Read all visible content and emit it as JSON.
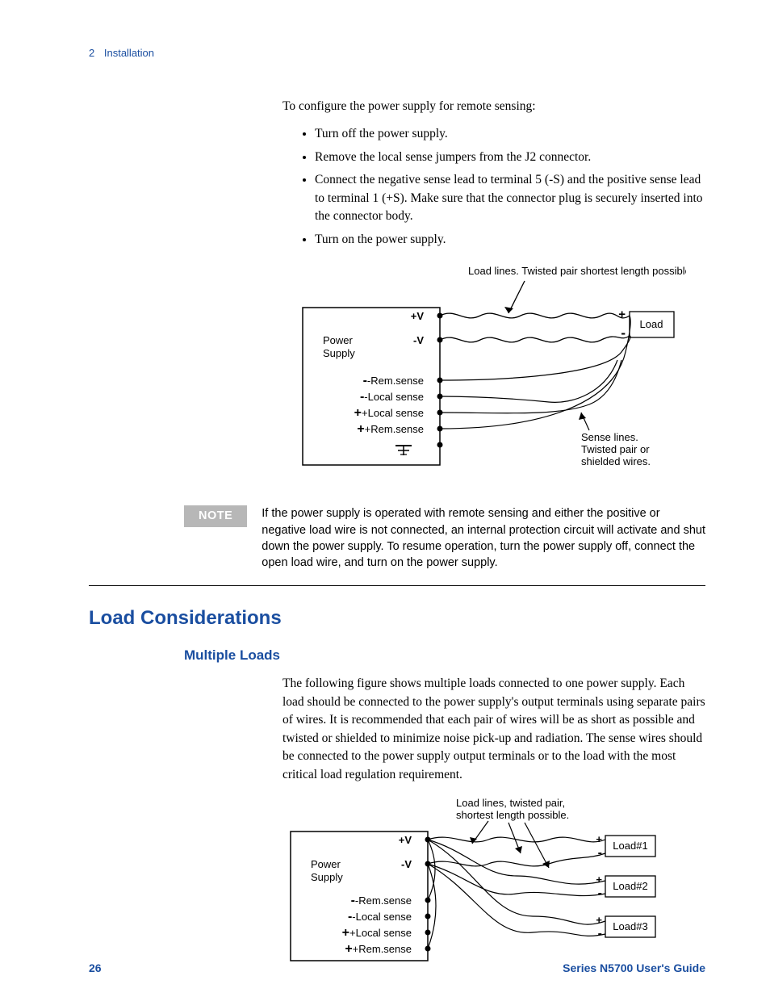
{
  "header": {
    "chapter_num": "2",
    "chapter_title": "Installation"
  },
  "intro": "To configure the power supply for remote sensing:",
  "steps": [
    "Turn off the power supply.",
    "Remove the local sense jumpers from the J2 connector.",
    "Connect the negative sense lead to terminal 5 (-S) and the positive sense lead to terminal 1 (+S). Make sure that the connector plug is securely inserted into the connector body.",
    "Turn on the power supply."
  ],
  "diagram1": {
    "caption_top": "Load lines. Twisted pair shortest length possible.",
    "ps_label": "Power Supply",
    "load_label": "Load",
    "plus_v": "+V",
    "minus_v": "-V",
    "neg_rem": "-Rem.sense",
    "neg_loc": "-Local sense",
    "pos_loc": "+Local sense",
    "pos_rem": "+Rem.sense",
    "caption_side": "Sense lines. Twisted pair or shielded wires.",
    "plus": "+",
    "minus": "-"
  },
  "note": {
    "label": "NOTE",
    "text": "If the power supply is operated with remote sensing and either the positive or negative load wire is not connected, an internal protection circuit will activate and shut down the power supply. To resume operation, turn the power supply off, connect the open load wire, and turn on the power supply."
  },
  "section": "Load Considerations",
  "subsection": "Multiple Loads",
  "multi_text": "The following figure shows multiple loads connected to one power supply. Each load should be connected to the power supply's output terminals using separate pairs of wires. It is recommended that each pair of wires will be as short as possible and twisted or shielded to minimize noise pick-up and radiation. The sense wires should be connected to the power supply output terminals or to the load with the most critical load regulation requirement.",
  "diagram2": {
    "caption_top": "Load lines,  twisted pair, shortest length possible.",
    "ps_label": "Power Supply",
    "plus_v": "+V",
    "minus_v": "-V",
    "neg_rem": "-Rem.sense",
    "neg_loc": "-Local  sense",
    "pos_loc": "+Local sense",
    "pos_rem": "+Rem.sense",
    "load1": "Load#1",
    "load2": "Load#2",
    "load3": "Load#3",
    "plus": "+",
    "minus": "-"
  },
  "footer": {
    "page": "26",
    "title": "Series N5700 User's Guide"
  }
}
